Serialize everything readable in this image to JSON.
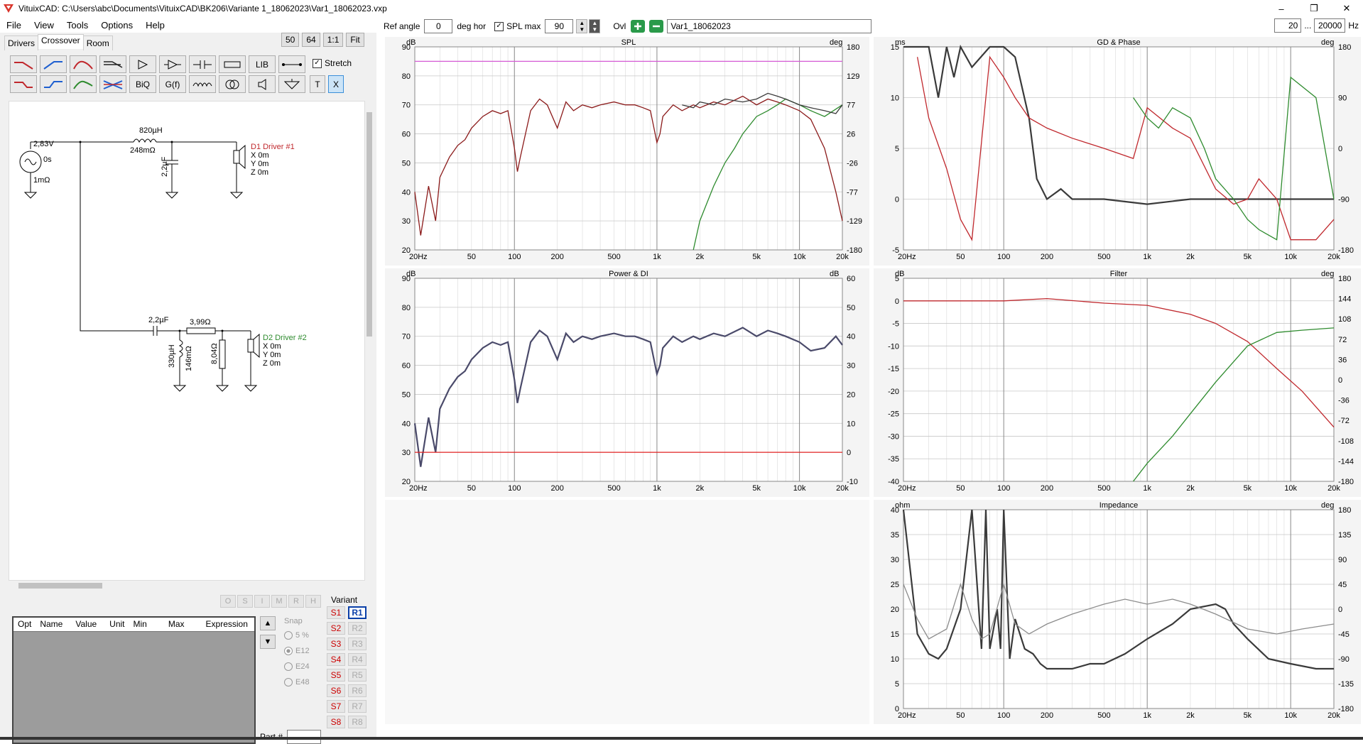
{
  "window": {
    "title": "VituixCAD: C:\\Users\\abc\\Documents\\VituixCAD\\BK206\\Variante 1_18062023\\Var1_18062023.vxp",
    "minimize": "–",
    "maximize": "❐",
    "close": "✕"
  },
  "menu": [
    "File",
    "View",
    "Tools",
    "Options",
    "Help"
  ],
  "tabs": [
    "Drivers",
    "Crossover",
    "Room"
  ],
  "zoom_buttons": [
    "50",
    "64",
    "1:1",
    "Fit"
  ],
  "palette": {
    "row1": [
      "",
      "",
      "",
      "",
      "",
      "",
      "",
      "",
      "LIB",
      ""
    ],
    "row2": [
      "",
      "",
      "",
      "",
      "BiQ",
      "G(f)",
      "",
      "",
      "",
      "",
      "T",
      "X"
    ],
    "stretch": "Stretch"
  },
  "schematic": {
    "source": {
      "voltage": "2,83V",
      "delay": "0s",
      "resistance": "1mΩ"
    },
    "series_inductor": {
      "value": "820µH",
      "resistance": "248mΩ"
    },
    "shunt_cap1": "2,2µF",
    "driver1": {
      "name": "D1 Driver #1",
      "x": "X 0m",
      "y": "Y 0m",
      "z": "Z 0m"
    },
    "cap2": "2,2µF",
    "resistor": "3,99Ω",
    "shunt_inductor": {
      "value": "330µH",
      "resistance": "146mΩ"
    },
    "shunt_resistor": "8,04Ω",
    "driver2": {
      "name": "D2 Driver #2",
      "x": "X 0m",
      "y": "Y 0m",
      "z": "Z 0m"
    }
  },
  "opt_buttons": [
    "O",
    "S",
    "I",
    "M",
    "R",
    "H"
  ],
  "param_table": {
    "headers": [
      "Opt",
      "Name",
      "Value",
      "Unit",
      "Min",
      "Max",
      "Expression"
    ]
  },
  "snap": {
    "label": "Snap",
    "options": [
      "5 %",
      "E12",
      "E24",
      "E48"
    ],
    "selected": "E12"
  },
  "part_label": "Part #",
  "variant": {
    "label": "Variant",
    "s": [
      "S1",
      "S2",
      "S3",
      "S4",
      "S5",
      "S6",
      "S7",
      "S8"
    ],
    "r": [
      "R1",
      "R2",
      "R3",
      "R4",
      "R5",
      "R6",
      "R7",
      "R8"
    ],
    "active": "R1"
  },
  "toolbar": {
    "ref_angle_label": "Ref angle",
    "ref_angle": "0",
    "deg_hor": "deg hor",
    "spl_max_label": "SPL max",
    "spl_max": "90",
    "ovl": "Ovl",
    "variant_name": "Var1_18062023",
    "f_min": "20",
    "dots": "...",
    "f_max": "20000",
    "hz": "Hz"
  },
  "colors": {
    "red": "#c0282d",
    "green": "#2e8b2e",
    "dark": "#3a3a3a",
    "grid": "#b8b8b8",
    "magenta": "#d45ad4",
    "navy": "#4a4a6a"
  },
  "x_ticks": [
    "20Hz",
    "50",
    "100",
    "200",
    "500",
    "1k",
    "2k",
    "5k",
    "10k",
    "20k"
  ],
  "graphs": {
    "spl": {
      "title": "SPL",
      "left_unit": "dB",
      "right_unit": "deg",
      "left_ticks": [
        "90",
        "80",
        "70",
        "60",
        "50",
        "40",
        "30",
        "20"
      ],
      "right_ticks": [
        "180",
        "129",
        "77",
        "26",
        "-26",
        "-77",
        "-129",
        "-180"
      ]
    },
    "gd": {
      "title": "GD & Phase",
      "left_unit": "ms",
      "right_unit": "deg",
      "left_ticks": [
        "15",
        "10",
        "5",
        "0",
        "-5"
      ],
      "right_ticks": [
        "180",
        "90",
        "0",
        "-90",
        "-180"
      ]
    },
    "power": {
      "title": "Power & DI",
      "left_unit": "dB",
      "right_unit": "dB",
      "left_ticks": [
        "90",
        "80",
        "70",
        "60",
        "50",
        "40",
        "30",
        "20"
      ],
      "right_ticks": [
        "60",
        "50",
        "40",
        "30",
        "20",
        "10",
        "0",
        "-10"
      ]
    },
    "filter": {
      "title": "Filter",
      "left_unit": "dB",
      "right_unit": "deg",
      "left_ticks": [
        "5",
        "0",
        "-5",
        "-10",
        "-15",
        "-20",
        "-25",
        "-30",
        "-35",
        "-40"
      ],
      "right_ticks": [
        "180",
        "144",
        "108",
        "72",
        "36",
        "0",
        "-36",
        "-72",
        "-108",
        "-144",
        "-180"
      ]
    },
    "impedance": {
      "title": "Impedance",
      "left_unit": "ohm",
      "right_unit": "deg",
      "left_ticks": [
        "40",
        "35",
        "30",
        "25",
        "20",
        "15",
        "10",
        "5",
        "0"
      ],
      "right_ticks": [
        "180",
        "135",
        "90",
        "45",
        "0",
        "-45",
        "-90",
        "-135",
        "-180"
      ]
    }
  },
  "chart_data": [
    {
      "type": "line",
      "title": "SPL",
      "ylabel": "dB",
      "ylim": [
        20,
        90
      ],
      "y2lim": [
        -180,
        180
      ],
      "xscale": "log",
      "xlim": [
        20,
        20000
      ],
      "series": [
        {
          "name": "",
          "color": "#8b1a1a",
          "x": [
            20,
            22,
            25,
            28,
            30,
            35,
            40,
            45,
            50,
            60,
            70,
            80,
            90,
            100,
            105,
            110,
            130,
            150,
            170,
            200,
            230,
            260,
            300,
            350,
            400,
            500,
            600,
            700,
            800,
            900,
            1000,
            1050,
            1100,
            1300,
            1500,
            1800,
            2000,
            2500,
            3000,
            4000,
            5000,
            6000,
            7000,
            8000,
            10000,
            12000,
            15000,
            18000,
            20000
          ],
          "y": [
            40,
            25,
            42,
            30,
            45,
            52,
            56,
            58,
            62,
            66,
            68,
            67,
            68,
            55,
            47,
            52,
            68,
            72,
            70,
            62,
            71,
            68,
            70,
            69,
            70,
            71,
            70,
            70,
            69,
            68,
            57,
            60,
            66,
            70,
            68,
            70,
            69,
            71,
            70,
            73,
            70,
            72,
            71,
            70,
            68,
            65,
            55,
            40,
            30
          ]
        },
        {
          "name": "",
          "color": "#2e8b2e",
          "x": [
            1800,
            2000,
            2500,
            3000,
            3500,
            4000,
            5000,
            6000,
            7000,
            8000,
            10000,
            12000,
            15000,
            20000
          ],
          "y": [
            20,
            30,
            42,
            50,
            55,
            60,
            66,
            68,
            70,
            72,
            70,
            68,
            66,
            70
          ]
        },
        {
          "name": "",
          "color": "#3a3a3a",
          "x": [
            1500,
            1800,
            2000,
            2500,
            3000,
            4000,
            5000,
            6000,
            7000,
            8000,
            10000,
            12000,
            15000,
            18000,
            20000
          ],
          "y": [
            70,
            69,
            71,
            70,
            72,
            71,
            72,
            74,
            73,
            72,
            70,
            69,
            68,
            67,
            70
          ]
        },
        {
          "name": "",
          "color": "#d45ad4",
          "x": [
            20,
            20000
          ],
          "y": [
            85,
            85
          ]
        }
      ]
    },
    {
      "type": "line",
      "title": "Power & DI",
      "ylabel": "dB",
      "ylim": [
        20,
        90
      ],
      "xscale": "log",
      "xlim": [
        20,
        20000
      ],
      "series": [
        {
          "name": "",
          "color": "#4a4a6a",
          "x": [
            20,
            22,
            25,
            28,
            30,
            35,
            40,
            45,
            50,
            60,
            70,
            80,
            90,
            100,
            105,
            110,
            130,
            150,
            170,
            200,
            230,
            260,
            300,
            350,
            400,
            500,
            600,
            700,
            800,
            900,
            1000,
            1050,
            1100,
            1300,
            1500,
            1800,
            2000,
            2500,
            3000,
            4000,
            5000,
            6000,
            7000,
            8000,
            10000,
            12000,
            15000,
            18000,
            20000
          ],
          "y": [
            40,
            25,
            42,
            30,
            45,
            52,
            56,
            58,
            62,
            66,
            68,
            67,
            68,
            55,
            47,
            52,
            68,
            72,
            70,
            62,
            71,
            68,
            70,
            69,
            70,
            71,
            70,
            70,
            69,
            68,
            57,
            60,
            66,
            70,
            68,
            70,
            69,
            71,
            70,
            73,
            70,
            72,
            71,
            70,
            68,
            65,
            66,
            70,
            67
          ]
        },
        {
          "name": "",
          "color": "#e02020",
          "x": [
            20,
            20000
          ],
          "y": [
            30,
            30
          ]
        }
      ]
    },
    {
      "type": "line",
      "title": "Filter",
      "ylabel": "dB",
      "ylim": [
        -40,
        5
      ],
      "xscale": "log",
      "xlim": [
        20,
        20000
      ],
      "series": [
        {
          "name": "",
          "color": "#c0282d",
          "x": [
            20,
            100,
            200,
            500,
            1000,
            2000,
            3000,
            5000,
            8000,
            12000,
            20000
          ],
          "y": [
            0,
            0,
            0.5,
            -0.5,
            -1,
            -3,
            -5,
            -9,
            -15,
            -20,
            -28
          ]
        },
        {
          "name": "",
          "color": "#2e8b2e",
          "x": [
            800,
            1000,
            1500,
            2000,
            3000,
            5000,
            8000,
            12000,
            20000
          ],
          "y": [
            -40,
            -36,
            -30,
            -25,
            -18,
            -10,
            -7,
            -6.5,
            -6
          ]
        }
      ]
    },
    {
      "type": "line",
      "title": "GD & Phase",
      "ylabel": "ms",
      "ylim": [
        -5,
        15
      ],
      "xscale": "log",
      "xlim": [
        20,
        20000
      ],
      "series": [
        {
          "name": "",
          "color": "#3a3a3a",
          "x": [
            20,
            30,
            35,
            40,
            45,
            50,
            60,
            80,
            100,
            120,
            150,
            170,
            200,
            250,
            300,
            500,
            1000,
            2000,
            5000,
            10000,
            20000
          ],
          "y": [
            15,
            15,
            10,
            15,
            12,
            15,
            13,
            15,
            15,
            14,
            8,
            2,
            0,
            1,
            0,
            0,
            -0.5,
            0,
            0,
            0,
            0
          ]
        },
        {
          "name": "",
          "color": "#c0282d",
          "x": [
            25,
            30,
            40,
            50,
            60,
            80,
            100,
            120,
            150,
            200,
            300,
            500,
            800,
            1000,
            1500,
            2000,
            3000,
            4000,
            5000,
            6000,
            8000,
            10000,
            15000,
            20000
          ],
          "y": [
            14,
            8,
            3,
            -2,
            -4,
            14,
            12,
            10,
            8,
            7,
            6,
            5,
            4,
            9,
            7,
            6,
            1,
            -0.5,
            0,
            2,
            0,
            -4,
            -4,
            -2
          ]
        },
        {
          "name": "",
          "color": "#2e8b2e",
          "x": [
            800,
            1000,
            1200,
            1500,
            2000,
            2500,
            3000,
            4000,
            5000,
            6000,
            8000,
            10000,
            15000,
            20000
          ],
          "y": [
            10,
            8,
            7,
            9,
            8,
            5,
            2,
            0,
            -2,
            -3,
            -4,
            12,
            10,
            0
          ]
        }
      ]
    },
    {
      "type": "line",
      "title": "Impedance",
      "ylabel": "ohm",
      "ylim": [
        0,
        40
      ],
      "xscale": "log",
      "xlim": [
        20,
        20000
      ],
      "series": [
        {
          "name": "",
          "color": "#3a3a3a",
          "x": [
            20,
            25,
            30,
            35,
            40,
            50,
            60,
            70,
            75,
            80,
            90,
            95,
            100,
            110,
            120,
            140,
            160,
            180,
            200,
            250,
            300,
            400,
            500,
            700,
            1000,
            1500,
            2000,
            3000,
            3500,
            4000,
            5000,
            7000,
            10000,
            15000,
            20000
          ],
          "y": [
            40,
            15,
            11,
            10,
            12,
            20,
            40,
            12,
            40,
            12,
            20,
            12,
            40,
            10,
            18,
            12,
            11,
            9,
            8,
            8,
            8,
            9,
            9,
            11,
            14,
            17,
            20,
            21,
            20,
            17,
            14,
            10,
            9,
            8,
            8
          ]
        },
        {
          "name": "",
          "color": "#8c8c8c",
          "x": [
            20,
            25,
            30,
            40,
            50,
            60,
            70,
            80,
            100,
            120,
            150,
            200,
            300,
            500,
            700,
            1000,
            1500,
            2000,
            3000,
            5000,
            8000,
            12000,
            20000
          ],
          "y": [
            25,
            18,
            14,
            16,
            25,
            18,
            14,
            15,
            25,
            17,
            15,
            17,
            19,
            21,
            22,
            21,
            22,
            21,
            19,
            16,
            15,
            16,
            17
          ]
        }
      ]
    }
  ]
}
